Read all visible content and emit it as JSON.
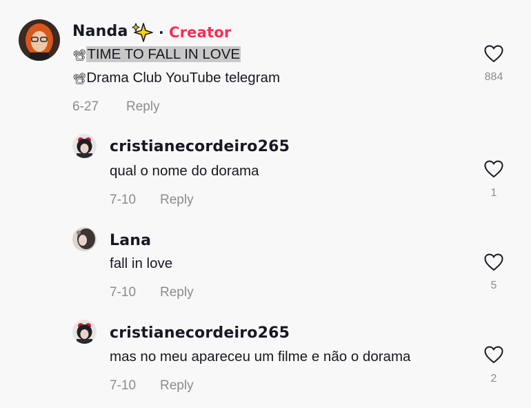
{
  "comments": [
    {
      "username": "Nanda",
      "creator_label": "Creator",
      "separator": "·",
      "line1_icon": "📽",
      "line1": "TIME TO FALL IN LOVE",
      "line2_icon": "📽",
      "line2": "Drama Club YouTube telegram",
      "date": "6-27",
      "reply_label": "Reply",
      "likes": "884"
    },
    {
      "username": "cristianecordeiro265",
      "text": "qual o nome do dorama",
      "date": "7-10",
      "reply_label": "Reply",
      "likes": "1"
    },
    {
      "username": "Lana",
      "text": "fall in love",
      "date": "7-10",
      "reply_label": "Reply",
      "likes": "5"
    },
    {
      "username": "cristianecordeiro265",
      "text": "mas no meu apareceu um filme e não o dorama",
      "date": "7-10",
      "reply_label": "Reply",
      "likes": "2"
    }
  ],
  "icons": {
    "sparkle": "sparkle-icon",
    "heart": "heart-icon"
  },
  "colors": {
    "creator": "#fe2c55",
    "muted": "#8a8b91",
    "text": "#161823",
    "background": "#f8f8f8"
  }
}
